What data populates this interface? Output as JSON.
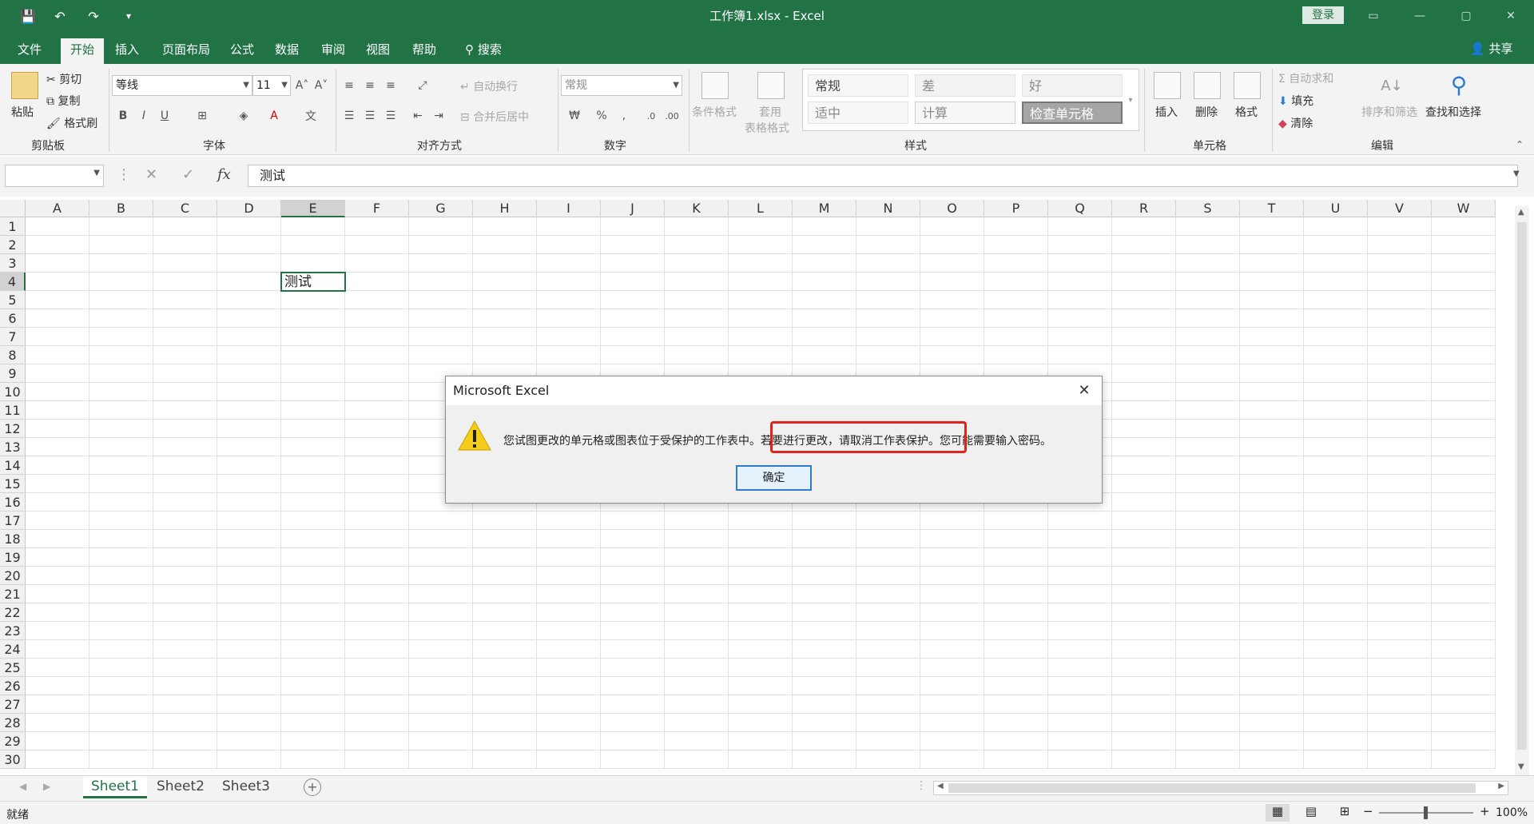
{
  "window": {
    "title": "工作簿1.xlsx  -  Excel",
    "login_label": "登录"
  },
  "tabs": [
    "文件",
    "开始",
    "插入",
    "页面布局",
    "公式",
    "数据",
    "审阅",
    "视图",
    "帮助",
    "搜索"
  ],
  "active_tab": "开始",
  "share_label": "共享",
  "ribbon": {
    "clipboard": {
      "paste": "粘贴",
      "cut": "剪切",
      "copy": "复制",
      "format_painter": "格式刷",
      "label": "剪贴板"
    },
    "font": {
      "name": "等线",
      "size": "11",
      "label": "字体"
    },
    "alignment": {
      "wrap": "自动换行",
      "merge": "合并后居中",
      "label": "对齐方式"
    },
    "number": {
      "format": "常规",
      "label": "数字"
    },
    "styles": {
      "conditional": "条件格式",
      "table_format_1": "套用",
      "table_format_2": "表格格式",
      "cells": [
        "常规",
        "差",
        "好",
        "适中",
        "计算",
        "检查单元格"
      ],
      "label": "样式"
    },
    "cells": {
      "insert": "插入",
      "delete": "删除",
      "format": "格式",
      "label": "单元格"
    },
    "editing": {
      "autosum": "自动求和",
      "fill": "填充",
      "clear": "清除",
      "sort_filter": "排序和筛选",
      "find_select": "查找和选择",
      "label": "编辑"
    }
  },
  "formula_bar": {
    "name_box": "",
    "content": "测试"
  },
  "grid": {
    "columns": [
      "A",
      "B",
      "C",
      "D",
      "E",
      "F",
      "G",
      "H",
      "I",
      "J",
      "K",
      "L",
      "M",
      "N",
      "O",
      "P",
      "Q",
      "R",
      "S",
      "T",
      "U",
      "V",
      "W"
    ],
    "rows": [
      "1",
      "2",
      "3",
      "4",
      "5",
      "6",
      "7",
      "8",
      "9",
      "10",
      "11",
      "12",
      "13",
      "14",
      "15",
      "16",
      "17",
      "18",
      "19",
      "20",
      "21",
      "22",
      "23",
      "24",
      "25",
      "26",
      "27",
      "28",
      "29",
      "30"
    ],
    "active_cell": {
      "ref": "E4",
      "value": "测试"
    }
  },
  "sheets": [
    "Sheet1",
    "Sheet2",
    "Sheet3"
  ],
  "active_sheet": "Sheet1",
  "status": {
    "ready": "就绪",
    "zoom": "100%"
  },
  "dialog": {
    "title": "Microsoft Excel",
    "message": "您试图更改的单元格或图表位于受保护的工作表中。若要进行更改，请取消工作表保护。您可能需要输入密码。",
    "ok": "确定"
  },
  "colors": {
    "excel_green": "#217346",
    "highlight_red": "#e0241b"
  }
}
